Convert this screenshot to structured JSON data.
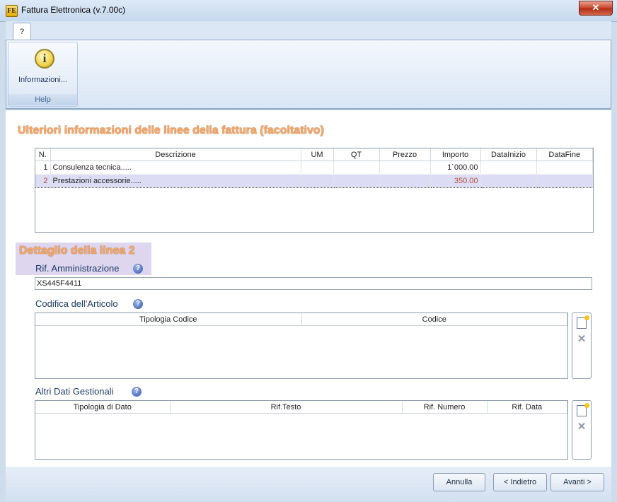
{
  "window": {
    "title": "Fattura Elettronica (v.7.00c)",
    "app_icon": "FE",
    "close_glyph": "✕"
  },
  "ribbon": {
    "tab": "?",
    "button_label": "Informazioni...",
    "button_icon": "info-icon",
    "group_label": "Help"
  },
  "section": {
    "heading": "Ulteriori informazioni delle linee della fattura (facoltativo)"
  },
  "lines_table": {
    "columns": [
      "N.",
      "Descrizione",
      "UM",
      "QT",
      "Prezzo",
      "Importo",
      "DataInizio",
      "DataFine"
    ],
    "rows": [
      {
        "n": "1",
        "descrizione": "Consulenza tecnica.....",
        "um": "",
        "qt": "",
        "prezzo": "",
        "importo": "1´000.00",
        "data_inizio": "",
        "data_fine": "",
        "selected": false
      },
      {
        "n": "2",
        "descrizione": "Prestazioni accessorie.....",
        "um": "",
        "qt": "",
        "prezzo": "",
        "importo": "350.00",
        "data_inizio": "",
        "data_fine": "",
        "selected": true
      }
    ]
  },
  "detail": {
    "heading": "Dettaglio della linea 2",
    "rif_amministrazione_label": "Rif. Amministrazione",
    "rif_amministrazione_value": "XS445F4411",
    "help_glyph": "?"
  },
  "codifica": {
    "label": "Codifica dell'Articolo",
    "columns": [
      "Tipologia Codice",
      "Codice"
    ]
  },
  "altri_dati": {
    "label": "Altri Dati Gestionali",
    "columns": [
      "Tipologia di Dato",
      "Rif.Testo",
      "Rif. Numero",
      "Rif. Data"
    ]
  },
  "footer": {
    "cancel": "Annulla",
    "back": "< Indietro",
    "next": "Avanti >"
  }
}
